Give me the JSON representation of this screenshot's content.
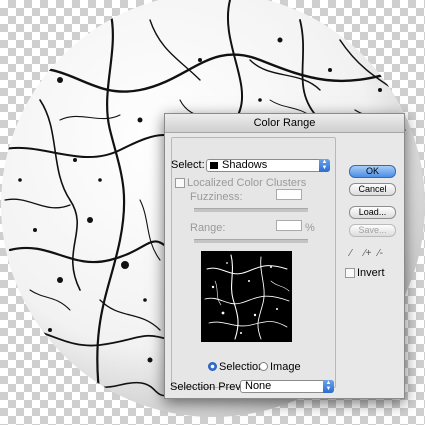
{
  "dialog": {
    "title": "Color Range",
    "select_label": "Select:",
    "select_value": "Shadows",
    "localized_label": "Localized Color Clusters",
    "fuzziness_label": "Fuzziness:",
    "range_label": "Range:",
    "range_unit": "%",
    "selection_label": "Selection",
    "image_label": "Image",
    "preview_mode": "selection",
    "selection_preview_label": "Selection Preview:",
    "selection_preview_value": "None",
    "invert_label": "Invert",
    "buttons": {
      "ok": "OK",
      "cancel": "Cancel",
      "load": "Load...",
      "save": "Save..."
    },
    "icons": [
      "eyedropper-icon",
      "eyedropper-plus-icon",
      "eyedropper-minus-icon",
      "popup-arrows-icon"
    ]
  },
  "colors": {
    "accent": "#2c6cd4",
    "dialog_bg": "#e8e8e8"
  }
}
